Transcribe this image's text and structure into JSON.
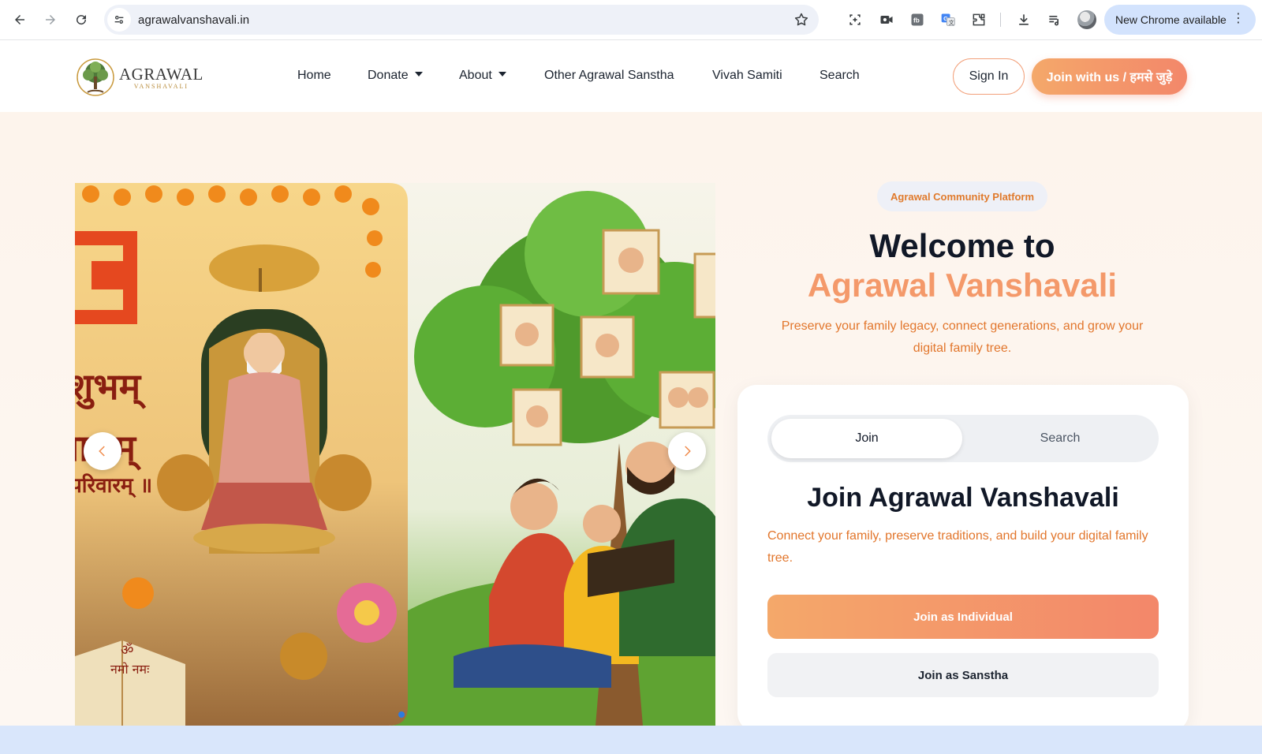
{
  "browser": {
    "url": "agrawalvanshavali.in",
    "update_label": "New Chrome available",
    "icons": [
      "back-icon",
      "forward-icon",
      "reload-icon",
      "site-info-icon",
      "bookmark-star-icon",
      "screenshot-icon",
      "video-icon",
      "fb-extension-icon",
      "translate-icon",
      "extensions-puzzle-icon",
      "download-icon",
      "reading-list-icon",
      "profile-avatar",
      "menu-dots-icon"
    ]
  },
  "header": {
    "logo_title": "AGRAWAL",
    "logo_subtitle": "VANSHAVALI",
    "nav": [
      {
        "label": "Home"
      },
      {
        "label": "Donate"
      },
      {
        "label": "About"
      },
      {
        "label": "Other Agrawal Sanstha"
      },
      {
        "label": "Vivah Samiti"
      },
      {
        "label": "Search"
      }
    ],
    "signin_label": "Sign In",
    "join_label": "Join with us / हमसे जुड़े"
  },
  "hero": {
    "badge": "Agrawal Community Platform",
    "welcome": "Welcome to",
    "brand": "Agrawal Vanshavali",
    "tagline": "Preserve your family legacy, connect generations, and grow your digital family tree.",
    "carousel": {
      "slide1_text": [
        "शुभम्",
        "लाभम्",
        "परिवारम् ॥"
      ],
      "slide1_book_text": [
        "ॐ",
        "नमो नमः"
      ]
    }
  },
  "card": {
    "tabs": [
      {
        "label": "Join"
      },
      {
        "label": "Search"
      }
    ],
    "active_tab": "Join",
    "title": "Join Agrawal Vanshavali",
    "description": "Connect your family, preserve traditions, and build your digital family tree.",
    "btn_individual": "Join as Individual",
    "btn_sanstha": "Join as Sanstha"
  },
  "colors": {
    "accent_orange": "#f4996a",
    "accent_text": "#e2762c",
    "dark_text": "#111827"
  }
}
